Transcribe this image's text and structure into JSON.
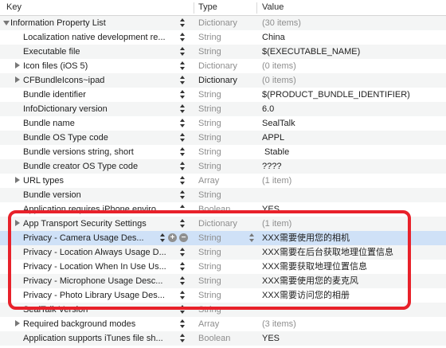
{
  "header": {
    "key": "Key",
    "type": "Type",
    "value": "Value"
  },
  "root": {
    "key": "Information Property List",
    "type": "Dictionary",
    "value": "(30 items)"
  },
  "rows": [
    {
      "key": "Localization native development re...",
      "type": "String",
      "value": "China"
    },
    {
      "key": "Executable file",
      "type": "String",
      "value": "$(EXECUTABLE_NAME)"
    },
    {
      "key": "Icon files (iOS 5)",
      "type": "Dictionary",
      "value": "(0 items)"
    },
    {
      "key": "CFBundleIcons~ipad",
      "type": "Dictionary",
      "value": "(0 items)"
    },
    {
      "key": "Bundle identifier",
      "type": "String",
      "value": "$(PRODUCT_BUNDLE_IDENTIFIER)"
    },
    {
      "key": "InfoDictionary version",
      "type": "String",
      "value": "6.0"
    },
    {
      "key": "Bundle name",
      "type": "String",
      "value": "SealTalk"
    },
    {
      "key": "Bundle OS Type code",
      "type": "String",
      "value": "APPL"
    },
    {
      "key": "Bundle versions string, short",
      "type": "String",
      "value": "Stable"
    },
    {
      "key": "Bundle creator OS Type code",
      "type": "String",
      "value": "????"
    },
    {
      "key": "URL types",
      "type": "Array",
      "value": "(1 item)"
    },
    {
      "key": "Bundle version",
      "type": "String",
      "value": ""
    },
    {
      "key": "Application requires iPhone enviro...",
      "type": "Boolean",
      "value": "YES"
    },
    {
      "key": "App Transport Security Settings",
      "type": "Dictionary",
      "value": "(1 item)"
    },
    {
      "key": "Privacy - Camera Usage Des...",
      "type": "String",
      "value": "XXX需要使用您的相机"
    },
    {
      "key": "Privacy - Location Always Usage D...",
      "type": "String",
      "value": "XXX需要在后台获取地理位置信息"
    },
    {
      "key": "Privacy - Location When In Use Us...",
      "type": "String",
      "value": "XXX需要获取地理位置信息"
    },
    {
      "key": "Privacy - Microphone Usage Desc...",
      "type": "String",
      "value": "XXX需要使用您的麦克风"
    },
    {
      "key": "Privacy - Photo Library Usage Des...",
      "type": "String",
      "value": "XXX需要访问您的相册"
    },
    {
      "key": "SealTalk Version",
      "type": "String",
      "value": ""
    },
    {
      "key": "Required background modes",
      "type": "Array",
      "value": "(3 items)"
    },
    {
      "key": "Application supports iTunes file sh...",
      "type": "Boolean",
      "value": "YES"
    }
  ],
  "colors": {
    "selection": "#cfe1f7",
    "highlight_border": "#e8212a"
  }
}
